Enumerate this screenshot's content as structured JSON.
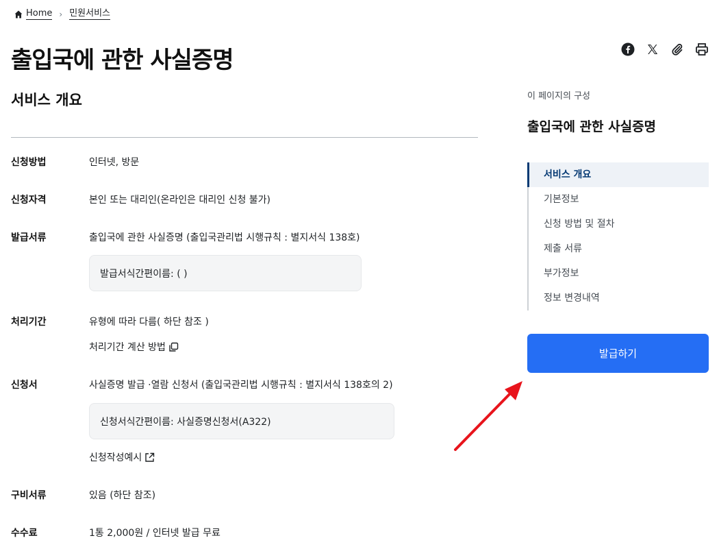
{
  "breadcrumb": {
    "home": "Home",
    "current": "민원서비스"
  },
  "page": {
    "title": "출입국에 관한 사실증명"
  },
  "share": {
    "icons": [
      "facebook-icon",
      "x-icon",
      "link-icon",
      "print-icon"
    ]
  },
  "overview": {
    "title": "서비스 개요",
    "rows": [
      {
        "label": "신청방법",
        "value": "인터넷, 방문"
      },
      {
        "label": "신청자격",
        "value": "본인 또는 대리인(온라인은 대리인 신청 불가)"
      },
      {
        "label": "발급서류",
        "value": "출입국에 관한 사실증명 (출입국관리법 시행규칙 : 별지서식 138호)",
        "note": "발급서식간편이름: ( )"
      },
      {
        "label": "처리기간",
        "value": "유형에 따라 다름( 하단 참조 )",
        "link": "처리기간 계산 방법"
      },
      {
        "label": "신청서",
        "value": "사실증명 발급 ·열람 신청서 (출입국관리법 시행규칙 : 별지서식 138호의 2)",
        "note": "신청서식간편이름: 사실증명신청서(A322)",
        "link": "신청작성예시"
      },
      {
        "label": "구비서류",
        "value": "있음 (하단 참조)"
      },
      {
        "label": "수수료",
        "value": "1통 2,000원 / 인터넷 발급 무료"
      }
    ]
  },
  "toc": {
    "caption": "이 페이지의 구성",
    "title": "출입국에 관한 사실증명",
    "items": [
      "서비스 개요",
      "기본정보",
      "신청 방법 및 절차",
      "제출 서류",
      "부가정보",
      "정보 변경내역"
    ]
  },
  "actions": {
    "issue_label": "발급하기"
  },
  "colors": {
    "primary": "#256ef4",
    "toc_active": "#063a74",
    "annotation": "#e8141c"
  }
}
